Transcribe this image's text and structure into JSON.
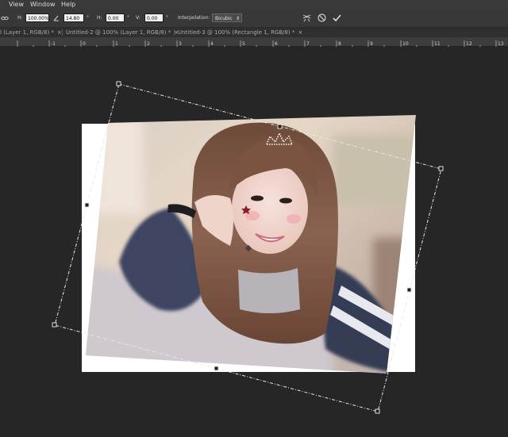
{
  "menubar": {
    "items": [
      "View",
      "Window",
      "Help"
    ]
  },
  "options": {
    "link_icon": "link-icon",
    "w_label": "H:",
    "w_value": "100.00%",
    "angle_icon": "angle-icon",
    "angle_value": "14.80",
    "angle_unit": "°",
    "h_label": "H:",
    "h_value": "0.00",
    "h_unit": "°",
    "v_label": "V:",
    "v_value": "0.00",
    "v_unit": "°",
    "interpolation_label": "Interpolation:",
    "interpolation_value": "Bicubic",
    "warp_icon": "warp-icon",
    "cancel_icon": "cancel-icon",
    "commit_icon": "checkmark-icon"
  },
  "tabs": [
    {
      "label": "l (Layer 1, RGB/8) *",
      "close": "×"
    },
    {
      "label": "Untitled-2 @ 100% (Layer 1, RGB/8) *",
      "close": "×"
    },
    {
      "label": "Untitled-3 @ 100% (Rectangle 1, RGB/8) *",
      "close": "×"
    }
  ],
  "ruler": {
    "labels": [
      "-1",
      "0",
      "1",
      "2",
      "3",
      "4",
      "5",
      "6",
      "7",
      "8",
      "9",
      "10",
      "11",
      "12",
      "13"
    ]
  },
  "colors": {
    "workspace": "#262626",
    "menubar": "#3a3a3a",
    "optionsbar": "#383838",
    "canvas": "#ffffff",
    "bounding_box": "#e8e8e8"
  }
}
